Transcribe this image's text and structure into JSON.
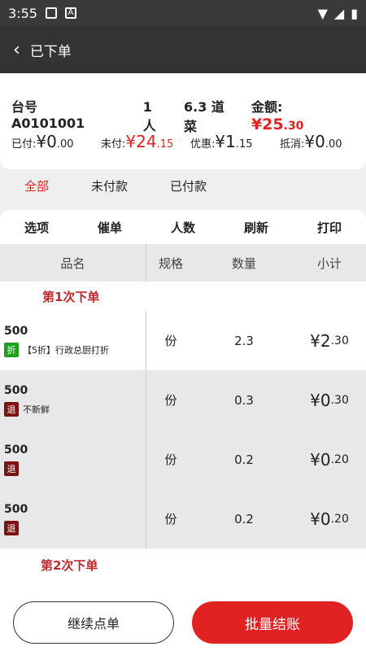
{
  "status": {
    "time": "3:55"
  },
  "appbar": {
    "back": "‹",
    "title": "已下单"
  },
  "summary": {
    "table_label": "台号",
    "table_no": "A0101001",
    "people": "1 人",
    "dishes": "6.3 道菜",
    "amount_label": "金额:",
    "amount_big": "¥25",
    "amount_small": ".30",
    "paid_label": "已付:",
    "paid_big": "¥0",
    "paid_small": ".00",
    "unpaid_label": "未付:",
    "unpaid_big": "¥24",
    "unpaid_small": ".15",
    "discount_label": "优惠:",
    "discount_big": "¥1",
    "discount_small": ".15",
    "writeoff_label": "抵消:",
    "writeoff_big": "¥0",
    "writeoff_small": ".00"
  },
  "tabs": [
    "全部",
    "未付款",
    "已付款"
  ],
  "actions": [
    "选项",
    "催单",
    "人数",
    "刷新",
    "打印"
  ],
  "table_header": [
    "品名",
    "规格",
    "数量",
    "小计"
  ],
  "groups": [
    {
      "title": "第1次下单"
    },
    {
      "title": "第2次下单"
    }
  ],
  "rows": [
    {
      "name": "500",
      "tag": "折",
      "tag_color": "#19a319",
      "note": "【5折】行政总厨打折",
      "unit": "份",
      "qty": "2.3",
      "price_big": "¥2",
      "price_small": ".30"
    },
    {
      "name": "500",
      "tag": "退",
      "tag_color": "#7a1313",
      "note": "不新鲜",
      "unit": "份",
      "qty": "0.3",
      "price_big": "¥0",
      "price_small": ".30"
    },
    {
      "name": "500",
      "tag": "退",
      "tag_color": "#7a1313",
      "note": "",
      "unit": "份",
      "qty": "0.2",
      "price_big": "¥0",
      "price_small": ".20"
    },
    {
      "name": "500",
      "tag": "退",
      "tag_color": "#7a1313",
      "note": "",
      "unit": "份",
      "qty": "0.2",
      "price_big": "¥0",
      "price_small": ".20"
    }
  ],
  "buttons": {
    "continue": "继续点单",
    "checkout": "批量结账"
  }
}
